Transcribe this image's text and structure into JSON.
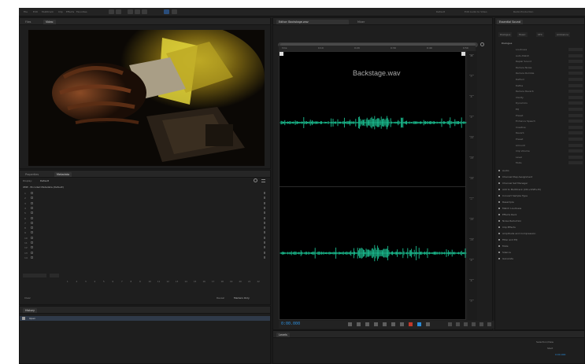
{
  "topbar": {
    "menu_items": [
      "File",
      "Edit",
      "Multitrack",
      "Clip",
      "Effects",
      "Favorites",
      "View",
      "Window",
      "Help"
    ],
    "workspace_items": [
      "Default",
      "Edit Audio to Video",
      "Radio Production"
    ]
  },
  "video_panel": {
    "tabs": [
      "Files",
      "Video"
    ]
  },
  "metadata_panel": {
    "tabs": [
      "Properties",
      "Metadata"
    ],
    "view_label": "Display:",
    "view_value": "Default",
    "header_row": "XMP - Encoded Metadata (Default)",
    "track_rows": [
      "1",
      "2",
      "3",
      "4",
      "5",
      "6",
      "7",
      "8",
      "9",
      "10",
      "11",
      "12",
      "13",
      "14"
    ],
    "scale_numbers": [
      "1",
      "2",
      "3",
      "4",
      "5",
      "6",
      "7",
      "8",
      "9",
      "10",
      "11",
      "12",
      "13",
      "14",
      "15",
      "16",
      "17",
      "18",
      "19",
      "20",
      "21",
      "22"
    ],
    "footer_left": "Clear",
    "footer_right": "Reveal",
    "footer_right_value": "Markers Only"
  },
  "history_panel": {
    "tabs": [
      "History"
    ],
    "item": "Open"
  },
  "editor_panel": {
    "tabs": [
      "Editor: Backstage.wav",
      "Mixer"
    ],
    "file_label": "Backstage.wav",
    "ruler_marks": [
      "hms",
      "0:10",
      "0:20",
      "0:30",
      "0:40",
      "0:50"
    ],
    "db_ticks": [
      "dB",
      "-3",
      "-6",
      "-9",
      "-12",
      "-15",
      "-21",
      "-∞",
      "-21",
      "-15",
      "-9",
      "-6",
      "-3"
    ],
    "waveform_color": "#1ed3a0"
  },
  "transport": {
    "timecode": "0:00.000",
    "buttons": [
      "stop",
      "play",
      "pause",
      "move-to-start",
      "rewind",
      "fast-forward",
      "move-to-end",
      "record",
      "loop",
      "skip-selected"
    ]
  },
  "levels_panel": {
    "tabs": [
      "Levels"
    ],
    "right_label": "Selection/View",
    "right_sub": "Start",
    "right_sub_value": "0:00.000"
  },
  "properties_panel": {
    "tabs": [
      "Essential Sound"
    ],
    "sub_tabs": [
      "Dialogue",
      "Music",
      "SFX",
      "Ambience"
    ],
    "section_title": "Dialogue",
    "rows": [
      "Loudness",
      "Auto-Match",
      "Repair Sound",
      "Reduce Noise",
      "Reduce Rumble",
      "DeHum",
      "DeEss",
      "Reduce Reverb",
      "Clarity",
      "Dynamics",
      "EQ",
      "Preset",
      "Enhance Speech",
      "Creative",
      "Reverb",
      "Preset",
      "Amount",
      "Clip Volume",
      "Level",
      "Mute"
    ],
    "lower_rows": [
      "Audio",
      "Channel Map Assignment",
      "Channel Set Manager",
      "Add to Multitrack (Ctrl+Shift+M)",
      "Convert Sample Type",
      "Resample",
      "Match Loudness",
      "Effects Rack",
      "Noise Reduction",
      "Clip Effects",
      "Amplitude and Compression",
      "Filter and EQ",
      "Mute",
      "Silence",
      "Generate"
    ],
    "bottom_label": "Selection/View",
    "bottom_value": "0:00.000"
  }
}
